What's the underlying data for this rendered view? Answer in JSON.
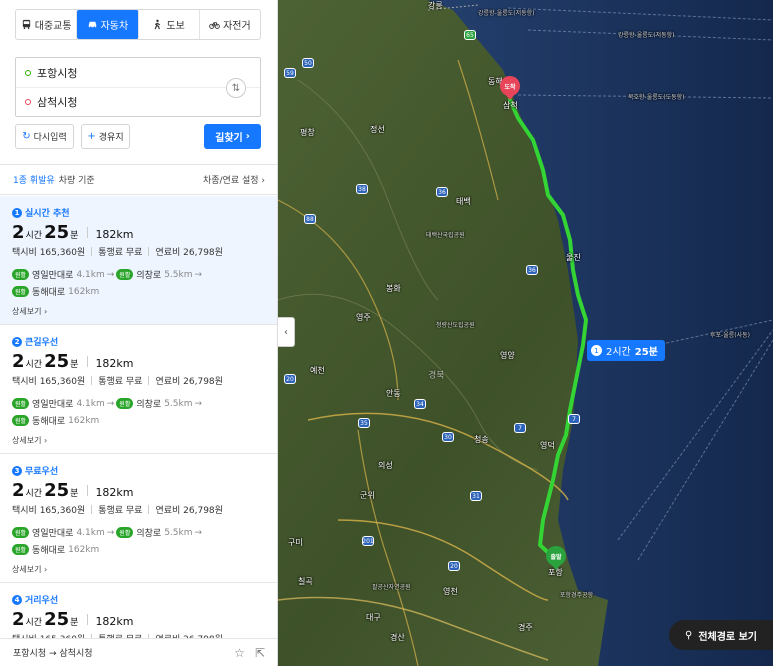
{
  "tabs": [
    {
      "label": "대중교통",
      "icon": "bus-icon",
      "active": false
    },
    {
      "label": "자동차",
      "icon": "car-icon",
      "active": true
    },
    {
      "label": "도보",
      "icon": "walk-icon",
      "active": false
    },
    {
      "label": "자전거",
      "icon": "bicycle-icon",
      "active": false
    }
  ],
  "search": {
    "origin": "포항시청",
    "destination": "삼척시청",
    "reset_label": "다시입력",
    "waypoint_label": "경유지",
    "find_label": "길찾기"
  },
  "vehicle": {
    "type_label": "1종 휘발유",
    "suffix": "차량 기준",
    "settings_label": "차종/연료 설정"
  },
  "routes": [
    {
      "num": "1",
      "name": "실시간 추천",
      "hours": "2",
      "hour_unit": "시간",
      "minutes": "25",
      "minute_unit": "분",
      "distance": "182km",
      "taxi": "택시비 165,360원",
      "toll": "통행료 무료",
      "fuel": "연료비 26,798원",
      "road1": "영일만대로",
      "road1_km": "4.1km",
      "road2": "의창로",
      "road2_km": "5.5km",
      "road3": "동해대로",
      "road3_km": "162km",
      "detail": "상세보기"
    },
    {
      "num": "2",
      "name": "큰길우선",
      "hours": "2",
      "hour_unit": "시간",
      "minutes": "25",
      "minute_unit": "분",
      "distance": "182km",
      "taxi": "택시비 165,360원",
      "toll": "통행료 무료",
      "fuel": "연료비 26,798원",
      "road1": "영일만대로",
      "road1_km": "4.1km",
      "road2": "의창로",
      "road2_km": "5.5km",
      "road3": "동해대로",
      "road3_km": "162km",
      "detail": "상세보기"
    },
    {
      "num": "3",
      "name": "무료우선",
      "hours": "2",
      "hour_unit": "시간",
      "minutes": "25",
      "minute_unit": "분",
      "distance": "182km",
      "taxi": "택시비 165,360원",
      "toll": "통행료 무료",
      "fuel": "연료비 26,798원",
      "road1": "영일만대로",
      "road1_km": "4.1km",
      "road2": "의창로",
      "road2_km": "5.5km",
      "road3": "동해대로",
      "road3_km": "162km",
      "detail": "상세보기"
    },
    {
      "num": "4",
      "name": "거리우선",
      "hours": "2",
      "hour_unit": "시간",
      "minutes": "25",
      "minute_unit": "분",
      "distance": "182km",
      "taxi": "택시비 165,360원",
      "toll": "통행료 무료",
      "fuel": "연료비 26,798원"
    }
  ],
  "road_badge": "원활",
  "footer": {
    "route_text": "포항시청 → 삼척시청"
  },
  "map": {
    "start_label": "출발",
    "end_label": "도착",
    "time_badge": {
      "num": "1",
      "hours": "2시간",
      "minutes": "25분"
    },
    "full_route_label": "전체경로 보기",
    "place_labels": [
      "강릉",
      "동해",
      "삼척",
      "정선",
      "태백",
      "봉화",
      "울진",
      "영양",
      "영주",
      "청송",
      "예천",
      "안동",
      "의성",
      "영덕",
      "군위",
      "포항",
      "구미",
      "칠곡",
      "영천",
      "대구",
      "경산",
      "경주",
      "평창",
      "경북",
      "태백산국립공원",
      "청량산도립공원",
      "팔공산자연공원",
      "포항경주공항"
    ],
    "sea_labels": [
      "강릉항-울릉도(저동항)",
      "강릉항-울릉도(저동항)",
      "묵호항-울릉도(도동항)",
      "후포-울릉(사동)"
    ],
    "shields": [
      "65",
      "50",
      "59",
      "38",
      "36",
      "88",
      "36",
      "7",
      "35",
      "34",
      "30",
      "31",
      "7",
      "20",
      "25",
      "20",
      "15",
      "201",
      "34",
      "35"
    ]
  },
  "colors": {
    "accent": "#1677ff",
    "route": "#33d433",
    "end_pin": "#e8455b",
    "start_pin": "#2aa23e"
  }
}
